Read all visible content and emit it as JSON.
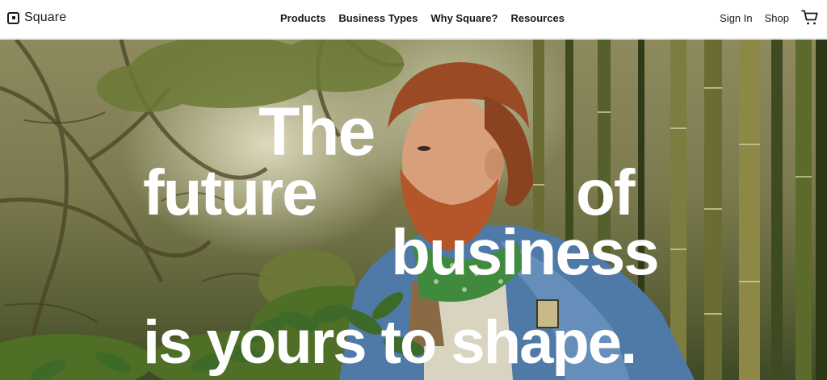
{
  "nav": {
    "logo_text": "Square",
    "links": [
      "Products",
      "Business Types",
      "Why Square?",
      "Resources"
    ],
    "sign_in": "Sign In",
    "shop": "Shop"
  },
  "hero": {
    "headline": {
      "line1": "The",
      "line2a": "future",
      "line2b": "of",
      "line3": "business",
      "line4": "is yours to shape."
    }
  },
  "colors": {
    "nav_background": "#ffffff",
    "nav_text": "#1a1a1a",
    "headline_text": "#ffffff"
  },
  "icons": {
    "logo": "square-logo-icon",
    "cart": "cart-icon"
  }
}
